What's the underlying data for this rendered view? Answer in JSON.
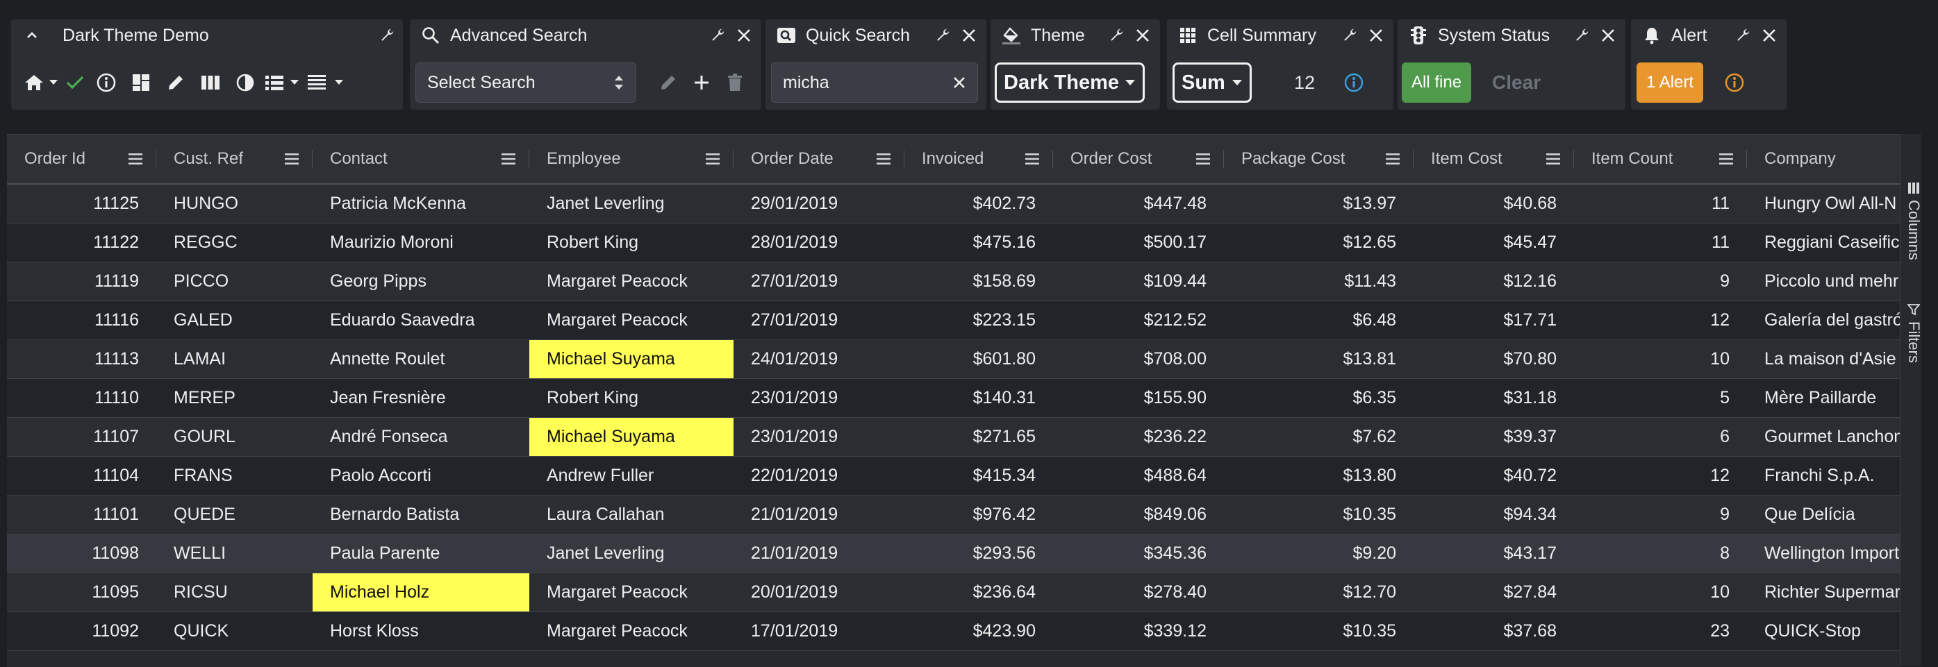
{
  "toolbar": {
    "dark_theme_demo": {
      "title": "Dark Theme Demo"
    },
    "advanced_search": {
      "title": "Advanced Search",
      "select_value": "Select Search"
    },
    "quick_search": {
      "title": "Quick Search",
      "value": "micha"
    },
    "theme": {
      "title": "Theme",
      "value": "Dark Theme"
    },
    "cell_summary": {
      "title": "Cell Summary",
      "operation": "Sum",
      "value": "12"
    },
    "system_status": {
      "title": "System Status",
      "status_button": "All fine",
      "clear_label": "Clear"
    },
    "alert": {
      "title": "Alert",
      "alert_button": "1 Alert"
    }
  },
  "grid": {
    "columns": [
      "Order Id",
      "Cust. Ref",
      "Contact",
      "Employee",
      "Order Date",
      "Invoiced",
      "Order Cost",
      "Package Cost",
      "Item Cost",
      "Item Count",
      "Company"
    ],
    "rows": [
      [
        "11125",
        "HUNGO",
        "Patricia McKenna",
        "Janet Leverling",
        "29/01/2019",
        "$402.73",
        "$447.48",
        "$13.97",
        "$40.68",
        "11",
        "Hungry Owl All-N"
      ],
      [
        "11122",
        "REGGC",
        "Maurizio Moroni",
        "Robert King",
        "28/01/2019",
        "$475.16",
        "$500.17",
        "$12.65",
        "$45.47",
        "11",
        "Reggiani Caseifici"
      ],
      [
        "11119",
        "PICCO",
        "Georg Pipps",
        "Margaret Peacock",
        "27/01/2019",
        "$158.69",
        "$109.44",
        "$11.43",
        "$12.16",
        "9",
        "Piccolo und mehr"
      ],
      [
        "11116",
        "GALED",
        "Eduardo Saavedra",
        "Margaret Peacock",
        "27/01/2019",
        "$223.15",
        "$212.52",
        "$6.48",
        "$17.71",
        "12",
        "Galería del gastró"
      ],
      [
        "11113",
        "LAMAI",
        "Annette Roulet",
        "Michael Suyama",
        "24/01/2019",
        "$601.80",
        "$708.00",
        "$13.81",
        "$70.80",
        "10",
        "La maison d'Asie"
      ],
      [
        "11110",
        "MEREP",
        "Jean Fresnière",
        "Robert King",
        "23/01/2019",
        "$140.31",
        "$155.90",
        "$6.35",
        "$31.18",
        "5",
        "Mère Paillarde"
      ],
      [
        "11107",
        "GOURL",
        "André Fonseca",
        "Michael Suyama",
        "23/01/2019",
        "$271.65",
        "$236.22",
        "$7.62",
        "$39.37",
        "6",
        "Gourmet Lanchon"
      ],
      [
        "11104",
        "FRANS",
        "Paolo Accorti",
        "Andrew Fuller",
        "22/01/2019",
        "$415.34",
        "$488.64",
        "$13.80",
        "$40.72",
        "12",
        "Franchi S.p.A."
      ],
      [
        "11101",
        "QUEDE",
        "Bernardo Batista",
        "Laura Callahan",
        "21/01/2019",
        "$976.42",
        "$849.06",
        "$10.35",
        "$94.34",
        "9",
        "Que Delícia"
      ],
      [
        "11098",
        "WELLI",
        "Paula Parente",
        "Janet Leverling",
        "21/01/2019",
        "$293.56",
        "$345.36",
        "$9.20",
        "$43.17",
        "8",
        "Wellington Import"
      ],
      [
        "11095",
        "RICSU",
        "Michael Holz",
        "Margaret Peacock",
        "20/01/2019",
        "$236.64",
        "$278.40",
        "$12.70",
        "$27.84",
        "10",
        "Richter Supermar"
      ],
      [
        "11092",
        "QUICK",
        "Horst Kloss",
        "Margaret Peacock",
        "17/01/2019",
        "$423.90",
        "$339.12",
        "$10.35",
        "$37.68",
        "23",
        "QUICK-Stop"
      ]
    ],
    "highlighted_cells": [
      [
        4,
        3
      ],
      [
        6,
        3
      ],
      [
        10,
        2
      ]
    ],
    "hovered_row": 9
  },
  "side_panel": {
    "columns_label": "Columns",
    "filters_label": "Filters"
  },
  "colors": {
    "highlight": "#ffff55",
    "status_green": "#4f9a4b",
    "alert_orange": "#e8972e",
    "info_blue": "#3aa0e0",
    "check_green": "#4caf50"
  }
}
